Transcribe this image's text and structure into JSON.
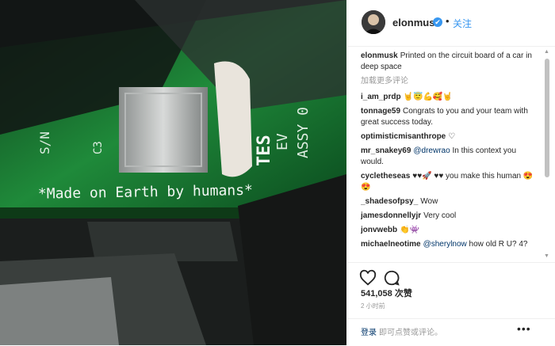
{
  "post": {
    "username": "elonmusk",
    "verified_glyph": "✔",
    "separator": "•",
    "follow_label": "关注",
    "caption": "Printed on the circuit board of a car in deep space",
    "load_more": "加载更多评论",
    "board_text": "*Made on Earth by humans*",
    "board_labels": {
      "sn": "S/N",
      "c3": "C3",
      "ev": "EV",
      "assy": "ASSY 0",
      "tes": "TES"
    }
  },
  "comments": [
    {
      "user": "i_am_prdp",
      "text": "🤘😇💪🥰🤘"
    },
    {
      "user": "tonnage59",
      "text": "Congrats to you and your team with great success today."
    },
    {
      "user": "optimisticmisanthrope",
      "text": "♡"
    },
    {
      "user": "mr_snakey69",
      "mention": "@drewrao",
      "text": " In this context you would."
    },
    {
      "user": "cycletheseas",
      "text": "♥♥🚀 ♥♥ you make this human 😍😍"
    },
    {
      "user": "_shadesofpsy_",
      "text": "Wow"
    },
    {
      "user": "jamesdonnellyjr",
      "text": "Very cool"
    },
    {
      "user": "jonvwebb",
      "text": "👏👾"
    },
    {
      "user": "michaelneotime",
      "mention": "@sherylnow",
      "text": " how old R U? 4?"
    }
  ],
  "stats": {
    "likes": "541,058 次赞",
    "time": "2 小时前"
  },
  "footer": {
    "login": "登录",
    "rest": "即可点赞或评论。",
    "more": "•••"
  },
  "icons": [
    "verified-icon",
    "heart-icon",
    "comment-icon",
    "more-options-icon"
  ],
  "colors": {
    "accent": "#3897f0",
    "board_green": "#1f8a3a",
    "link": "#003569"
  }
}
